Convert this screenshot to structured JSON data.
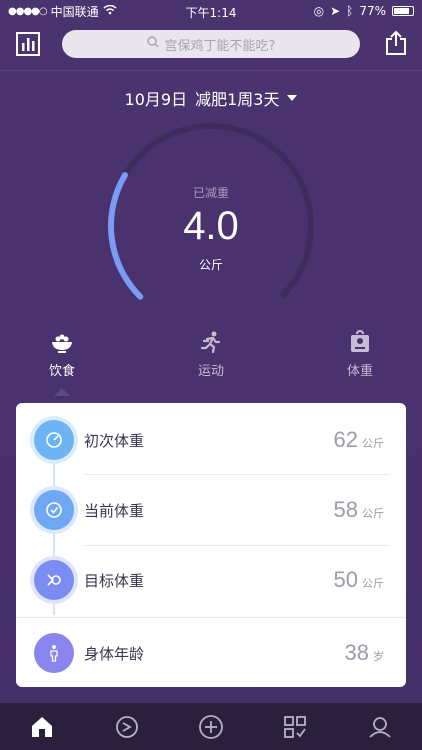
{
  "status": {
    "carrier": "中国联通",
    "time": "下午1:14",
    "battery": "77%"
  },
  "search": {
    "placeholder": "宫保鸡丁能不能吃?"
  },
  "header": {
    "date": "10月9日",
    "program": "减肥1周3天"
  },
  "progress": {
    "label": "已减重",
    "value": "4.0",
    "unit": "公斤",
    "fraction": 0.28
  },
  "tabs": [
    {
      "label": "饮食",
      "icon": "bowl-icon"
    },
    {
      "label": "运动",
      "icon": "runner-icon"
    },
    {
      "label": "体重",
      "icon": "scale-icon"
    }
  ],
  "weights": [
    {
      "label": "初次体重",
      "value": "62",
      "unit": "公斤",
      "icon": "gauge-icon",
      "color": "#6db5f2"
    },
    {
      "label": "当前体重",
      "value": "58",
      "unit": "公斤",
      "icon": "check-icon",
      "color": "#6fa8f2"
    },
    {
      "label": "目标体重",
      "value": "50",
      "unit": "公斤",
      "icon": "target-arrow-icon",
      "color": "#7b8cf0"
    },
    {
      "label": "身体年龄",
      "value": "38",
      "unit": "岁",
      "icon": "person-icon",
      "color": "#8a84ee"
    }
  ],
  "colors": {
    "accent": "#7a9cf5",
    "background": "#4a326e",
    "nav": "#2a1f3c"
  }
}
